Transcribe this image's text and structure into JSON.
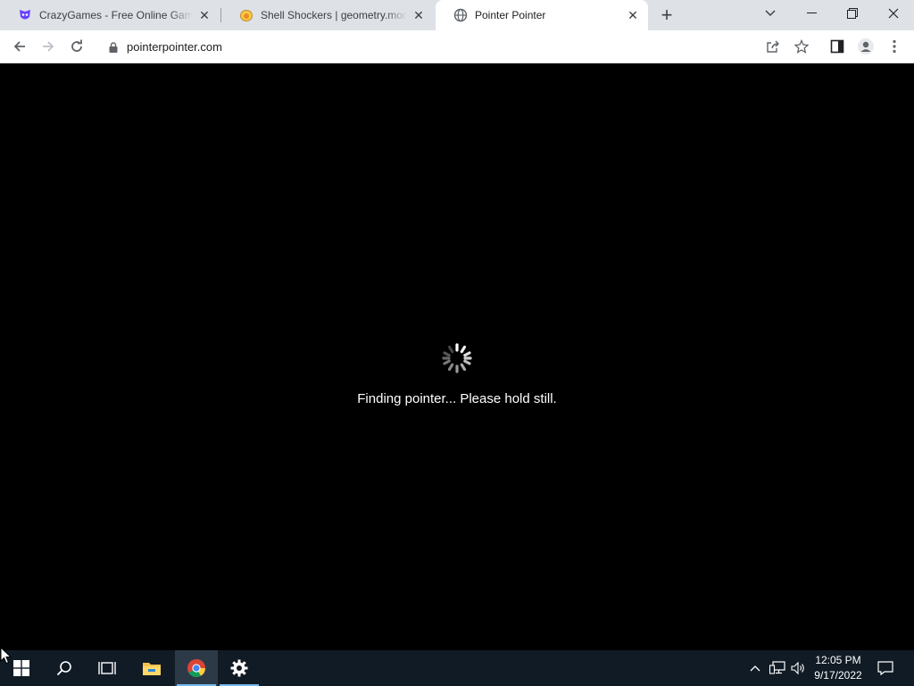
{
  "tabs": [
    {
      "title": "CrazyGames - Free Online Games",
      "favicon": "crazygames-icon"
    },
    {
      "title": "Shell Shockers | geometry.monster",
      "favicon": "shellshockers-icon"
    },
    {
      "title": "Pointer Pointer",
      "favicon": "globe-icon",
      "active": true
    }
  ],
  "toolbar": {
    "url": "pointerpointer.com"
  },
  "page": {
    "status_text": "Finding pointer... Please hold still."
  },
  "taskbar": {
    "time": "12:05 PM",
    "date": "9/17/2022"
  },
  "colors": {
    "tabstrip_bg": "#dee1e6",
    "page_bg": "#000000",
    "taskbar_bg": "#101b26",
    "accent": "#76b9ed"
  }
}
